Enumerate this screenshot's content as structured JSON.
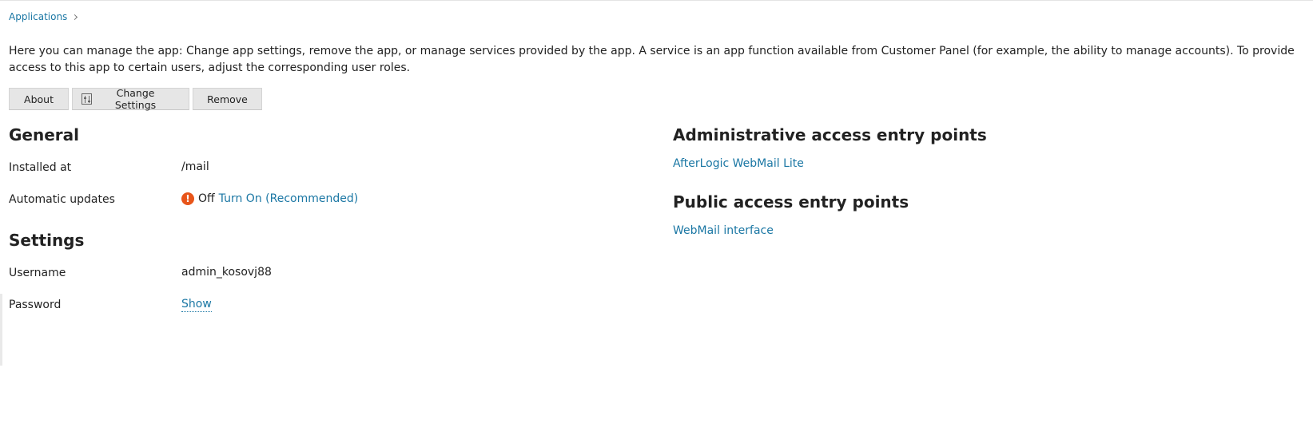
{
  "breadcrumb": {
    "label": "Applications"
  },
  "intro": "Here you can manage the app: Change app settings, remove the app, or manage services provided by the app. A service is an app function available from Customer Panel (for example, the ability to manage accounts). To provide access to this app to certain users, adjust the corresponding user roles.",
  "toolbar": {
    "about": "About",
    "change_settings": "Change Settings",
    "remove": "Remove"
  },
  "general": {
    "title": "General",
    "installed_at": {
      "label": "Installed at",
      "value": "/mail"
    },
    "automatic_updates": {
      "label": "Automatic updates",
      "status": "Off",
      "action": "Turn On (Recommended)",
      "status_icon": "warning-icon"
    }
  },
  "settings": {
    "title": "Settings",
    "username": {
      "label": "Username",
      "value": "admin_kosovj88"
    },
    "password": {
      "label": "Password",
      "action": "Show"
    }
  },
  "admin_entry_points": {
    "title": "Administrative access entry points",
    "items": [
      "AfterLogic WebMail Lite"
    ]
  },
  "public_entry_points": {
    "title": "Public access entry points",
    "items": [
      "WebMail interface"
    ]
  },
  "colors": {
    "link": "#1b77a4",
    "warning": "#e8551a",
    "button_bg": "#e6e6e6"
  }
}
